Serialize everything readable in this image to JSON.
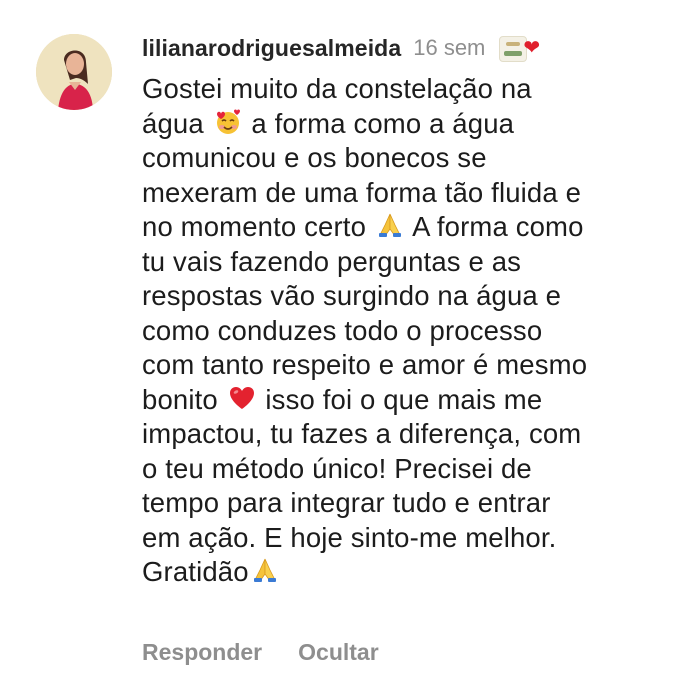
{
  "comment": {
    "username": "lilianarodriguesalmeida",
    "timestamp": "16 sem",
    "reaction_icon": "profile-badge-with-heart-icon",
    "text_segments": [
      {
        "text": "Gostei muito da constelação na\nágua "
      },
      {
        "emoji": "smiling-face-with-hearts-icon"
      },
      {
        "text": " a forma como a água\ncomunicou e os bonecos se\nmexeram de uma forma tão fluida e\nno momento certo "
      },
      {
        "emoji": "folded-hands-icon"
      },
      {
        "text": " A forma como\ntu vais fazendo perguntas e as\nrespostas vão surgindo na água e\ncomo conduzes todo o processo\ncom tanto respeito e amor é mesmo\nbonito "
      },
      {
        "emoji": "red-heart-icon"
      },
      {
        "text": " isso foi o que mais me\nimpactou, tu fazes a diferença, com\no teu método único! Precisei de\ntempo para integrar tudo e entrar\nem ação. E hoje sinto-me melhor.\nGratidão"
      },
      {
        "emoji": "folded-hands-icon"
      }
    ],
    "actions": {
      "reply_label": "Responder",
      "hide_label": "Ocultar"
    }
  },
  "colors": {
    "username": "#262626",
    "body_text": "#1c1c1c",
    "meta_gray": "#8e8e8e",
    "heart_red": "#e0202d"
  }
}
